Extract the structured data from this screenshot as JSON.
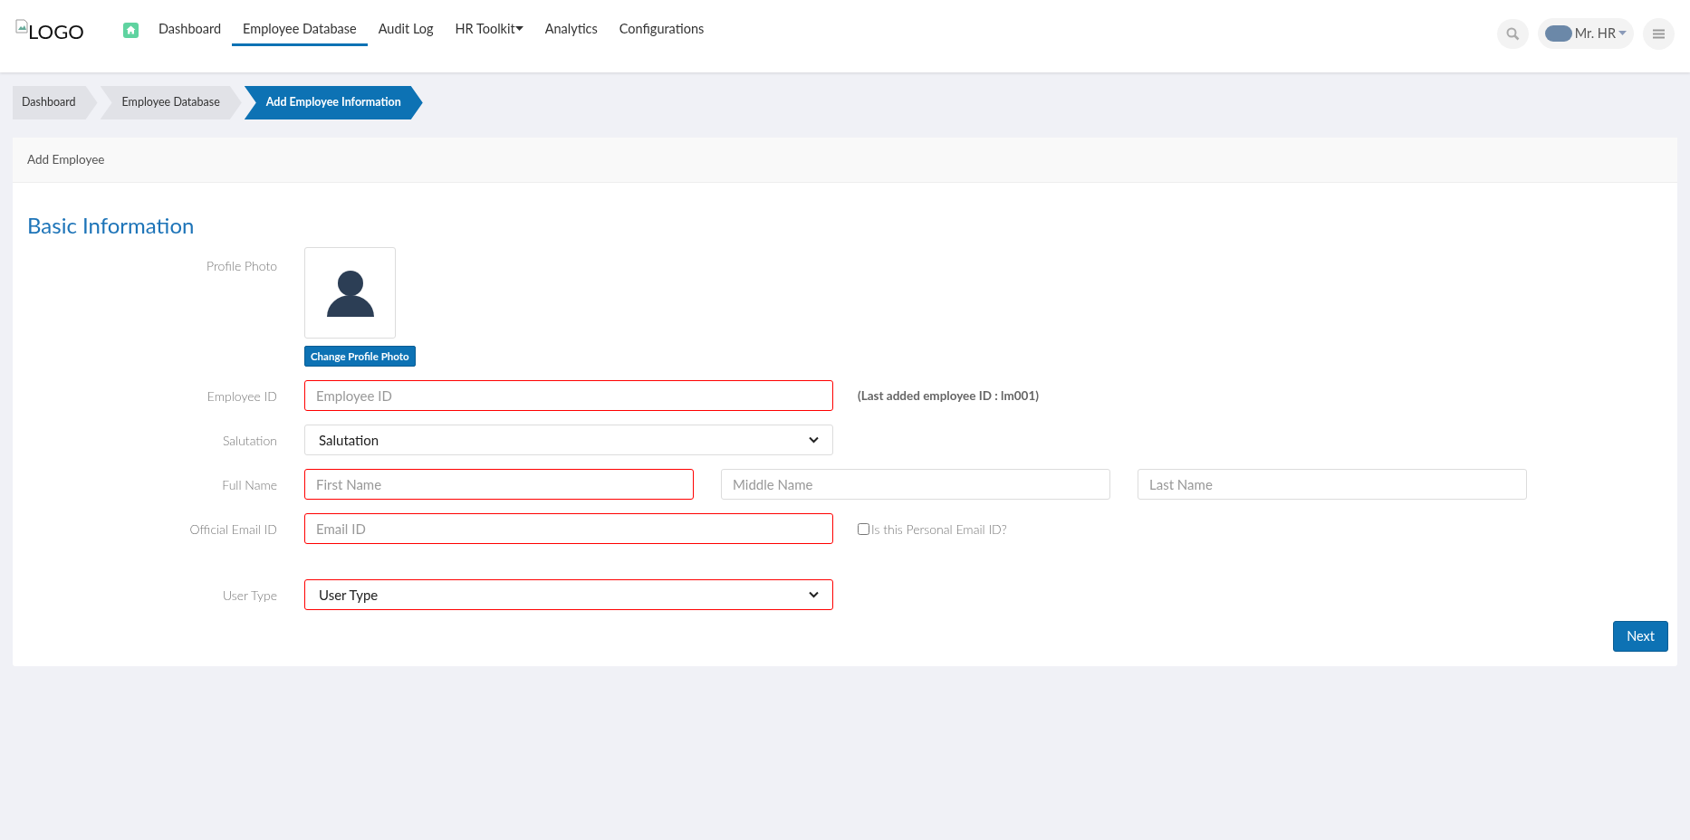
{
  "header": {
    "logo_text": "LOGO",
    "nav": [
      {
        "label": "Dashboard",
        "selected": false,
        "dropdown": false
      },
      {
        "label": "Employee Database",
        "selected": true,
        "dropdown": false
      },
      {
        "label": "Audit Log",
        "selected": false,
        "dropdown": false
      },
      {
        "label": "HR Toolkit",
        "selected": false,
        "dropdown": true
      },
      {
        "label": "Analytics",
        "selected": false,
        "dropdown": false
      },
      {
        "label": "Configurations",
        "selected": false,
        "dropdown": false
      }
    ],
    "user": {
      "name": "Mr. HR"
    }
  },
  "breadcrumb": [
    {
      "label": "Dashboard",
      "selected": false
    },
    {
      "label": "Employee Database",
      "selected": false
    },
    {
      "label": "Add Employee Information",
      "selected": true
    }
  ],
  "card": {
    "title": "Add Employee",
    "section": "Basic Information",
    "fields": [
      {
        "kind": "photo",
        "label": "Profile Photo",
        "button": "Change Profile Photo"
      },
      {
        "kind": "input",
        "label": "Employee ID",
        "placeholder": "Employee ID",
        "error": true,
        "note": "(Last added employee ID : lm001)"
      },
      {
        "kind": "select",
        "label": "Salutation",
        "value": "Salutation",
        "error": false
      },
      {
        "kind": "name",
        "label": "Full Name",
        "parts": [
          {
            "placeholder": "First Name",
            "error": true
          },
          {
            "placeholder": "Middle Name",
            "error": false
          },
          {
            "placeholder": "Last Name",
            "error": false
          }
        ]
      },
      {
        "kind": "input",
        "label": "Official Email ID",
        "placeholder": "Email ID",
        "error": true,
        "checkbox": {
          "label": "Is this Personal Email ID?",
          "checked": false
        }
      },
      {
        "kind": "select",
        "label": "User Type",
        "value": "User Type",
        "error": true
      }
    ],
    "next_button": "Next"
  }
}
